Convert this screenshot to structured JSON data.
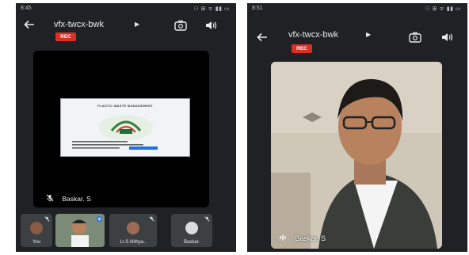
{
  "left_screen": {
    "status": {
      "time": "8:45",
      "icons": "⚆ ⊞ ᯤ ▮▮ ▭"
    },
    "header": {
      "back_icon": "arrow-left-icon",
      "meeting_code": "vfx-twcx-bwk",
      "rec_label": "REC"
    },
    "shared_slide": {
      "title": "PLASTIC WASTE MANAGEMENT"
    },
    "main_tile": {
      "name": "Baskar. S"
    },
    "participants": [
      {
        "label": "You"
      },
      {
        "label": ""
      },
      {
        "label": "Lt.S.Nithya.."
      },
      {
        "label": "Baskar."
      }
    ]
  },
  "right_screen": {
    "status": {
      "time": "8:51",
      "icons": "⚆ ⊞ ᯤ ▮▮ ▭"
    },
    "header": {
      "back_icon": "arrow-left-icon",
      "meeting_code": "vfx-twcx-bwk",
      "rec_label": "REC"
    },
    "video_tile": {
      "name": "Baskar. S"
    }
  },
  "colors": {
    "background": "#202124",
    "rec": "#d93025",
    "text": "#e8eaed"
  }
}
